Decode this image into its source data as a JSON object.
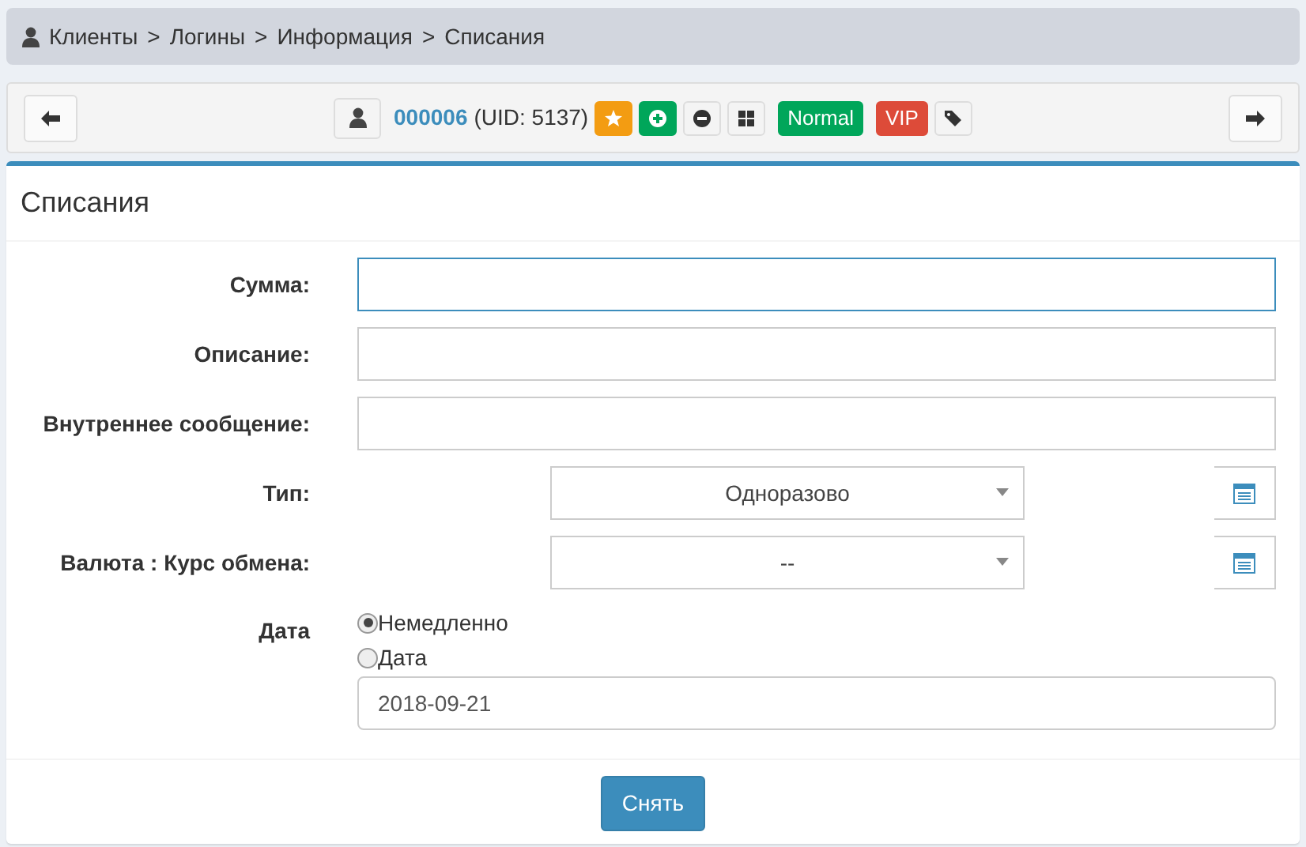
{
  "breadcrumb": [
    "Клиенты",
    "Логины",
    "Информация",
    "Списания"
  ],
  "breadcrumb_separator": ">",
  "toolbar": {
    "login_id": "000006",
    "uid_text": "(UID: 5137)",
    "badges": [
      {
        "kind": "star",
        "color": "#f39c12"
      },
      {
        "kind": "plus",
        "color": "#00a65a"
      },
      {
        "kind": "minus",
        "color": "#f4f4f4"
      },
      {
        "kind": "grid",
        "color": "#f4f4f4"
      },
      {
        "kind": "label",
        "text": "Normal",
        "color": "#00a65a"
      },
      {
        "kind": "label",
        "text": "VIP",
        "color": "#dd4b39"
      },
      {
        "kind": "tags",
        "color": "#f4f4f4"
      }
    ]
  },
  "card_title": "Списания",
  "fields": [
    {
      "kind": "text",
      "label": "Сумма:",
      "focused": true
    },
    {
      "kind": "text",
      "label": "Описание:",
      "focused": false
    },
    {
      "kind": "text",
      "label": "Внутреннее сообщение:",
      "focused": false
    },
    {
      "kind": "select",
      "label": "Тип:",
      "value": "Одноразово"
    },
    {
      "kind": "select",
      "label": "Валюта : Курс обмена:",
      "value": "--"
    },
    {
      "kind": "date",
      "label": "Дата",
      "options": [
        {
          "label": "Немедленно",
          "selected": true
        },
        {
          "label": "Дата",
          "selected": false
        }
      ],
      "value": "2018-09-21"
    }
  ],
  "submit": "Снять"
}
